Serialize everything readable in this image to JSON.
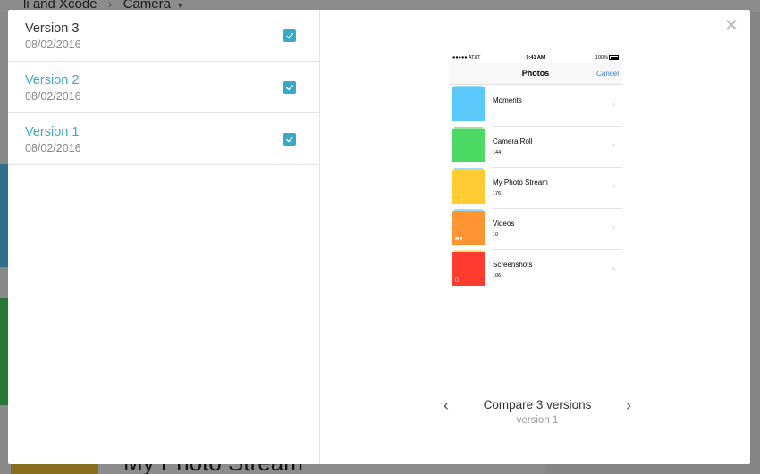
{
  "background": {
    "breadcrumb_project": "li and Xcode",
    "breadcrumb_current": "Camera",
    "bottom_title": "My Photo Stream"
  },
  "versions": [
    {
      "name": "Version 3",
      "date": "08/02/2016",
      "checked": true
    },
    {
      "name": "Version 2",
      "date": "08/02/2016",
      "checked": true
    },
    {
      "name": "Version 1",
      "date": "08/02/2016",
      "checked": true
    }
  ],
  "preview": {
    "status": {
      "carrier": "●●●●● AT&T",
      "time": "9:41 AM",
      "battery": "100%"
    },
    "title": "Photos",
    "cancel_label": "Cancel",
    "albums": [
      {
        "name": "Moments",
        "count": "",
        "color": "#5ac8fa"
      },
      {
        "name": "Camera Roll",
        "count": "144",
        "color": "#4cd964"
      },
      {
        "name": "My Photo Stream",
        "count": "176",
        "color": "#ffcc33"
      },
      {
        "name": "Videos",
        "count": "10",
        "color": "#ff9533"
      },
      {
        "name": "Screenshots",
        "count": "106",
        "color": "#ff3b30"
      }
    ]
  },
  "pager": {
    "title": "Compare 3 versions",
    "subtitle": "version 1"
  },
  "colors": {
    "accent": "#39a8c8"
  }
}
